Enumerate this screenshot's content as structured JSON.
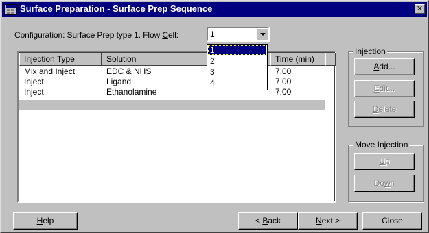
{
  "window": {
    "title": "Surface Preparation - Surface Prep Sequence",
    "close_glyph": "✕"
  },
  "config": {
    "label_prefix": "Configuration: Surface Prep type 1. Flow ",
    "label_accel": "C",
    "label_suffix": "ell:",
    "flow_cell_value": "1",
    "flow_cell_options": [
      "1",
      "2",
      "3",
      "4"
    ],
    "selected_option_index": 0
  },
  "table": {
    "columns": [
      "Injection Type",
      "Solution",
      "Time (min)"
    ],
    "rows": [
      {
        "type": "Mix and Inject",
        "solution": "EDC & NHS",
        "time": "7,00"
      },
      {
        "type": "Inject",
        "solution": "Ligand",
        "time": "7,00"
      },
      {
        "type": "Inject",
        "solution": "Ethanolamine",
        "time": "7,00"
      }
    ]
  },
  "injection_group": {
    "title": "Injection",
    "add": {
      "pre": "",
      "accel": "A",
      "post": "dd..."
    },
    "edit": {
      "pre": "",
      "accel": "E",
      "post": "dit..."
    },
    "delete": {
      "pre": "",
      "accel": "D",
      "post": "elete"
    }
  },
  "move_group": {
    "title": "Move Injection",
    "up": {
      "pre": "",
      "accel": "U",
      "post": "p"
    },
    "down": {
      "pre": "Do",
      "accel": "w",
      "post": "n"
    }
  },
  "footer": {
    "help": {
      "pre": "",
      "accel": "H",
      "post": "elp"
    },
    "back": {
      "pre": "< ",
      "accel": "B",
      "post": "ack"
    },
    "next": {
      "pre": "",
      "accel": "N",
      "post": "ext >"
    },
    "close": {
      "pre": "",
      "accel": "",
      "post": "Close"
    }
  },
  "colors": {
    "titlebar": "#000080",
    "face": "#c0c0c0",
    "selection": "#000080"
  }
}
